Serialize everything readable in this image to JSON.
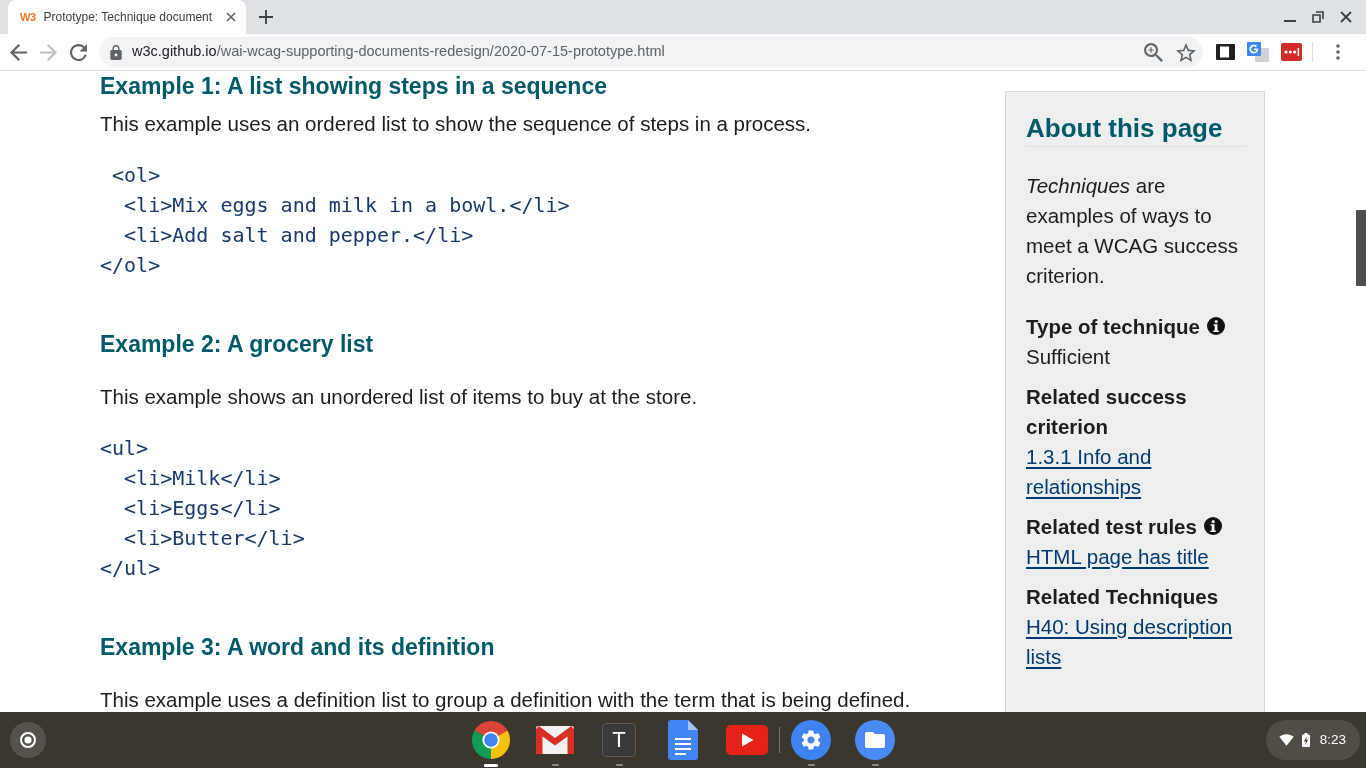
{
  "browser": {
    "tabs": [
      {
        "favicon": "W3",
        "title": "Prototype: Technique document",
        "selected": true
      }
    ],
    "nav_buttons": [
      {
        "kind": "back",
        "disabled": false
      },
      {
        "kind": "forward",
        "disabled": true
      },
      {
        "kind": "reload",
        "disabled": false
      }
    ],
    "address": {
      "host": "w3c.github.io",
      "path": "/wai-wcag-supporting-documents-redesign/2020-07-15-prototype.html"
    }
  },
  "article": {
    "blocks": [
      {
        "kind": "heading",
        "text": "Example 1: A list showing steps in a sequence"
      },
      {
        "kind": "paragraph",
        "text": "This example uses an ordered list to show the sequence of steps in a process."
      },
      {
        "kind": "code",
        "lines": [
          " <ol>",
          "  <li>Mix eggs and milk in a bowl.</li>",
          "  <li>Add salt and pepper.</li>",
          "</ol>"
        ]
      },
      {
        "kind": "heading",
        "text": "Example 2: A grocery list"
      },
      {
        "kind": "paragraph",
        "text": "This example shows an unordered list of items to buy at the store."
      },
      {
        "kind": "code",
        "lines": [
          "<ul>",
          "  <li>Milk</li>",
          "  <li>Eggs</li>",
          "  <li>Butter</li>",
          "</ul>"
        ]
      },
      {
        "kind": "heading",
        "text": "Example 3: A word and its definition"
      },
      {
        "kind": "paragraph",
        "text": "This example uses a definition list to group a definition with the term that is being defined."
      }
    ]
  },
  "sidebar": {
    "title": "About this page",
    "intro": "*Techniques* are examples of ways to meet a WCAG success criterion.",
    "sections": [
      {
        "heading": "Type of technique",
        "info": true,
        "value": "Sufficient"
      },
      {
        "heading": "Related success criterion",
        "info": false,
        "link": "1.3.1 Info and relationships"
      },
      {
        "heading": "Related test rules",
        "info": true,
        "link": "HTML page has title"
      },
      {
        "heading": "Related Techniques",
        "info": false,
        "link": "H40: Using description lists"
      }
    ]
  },
  "shelf": {
    "app_groups": [
      [
        {
          "kind": "browser",
          "running": true,
          "active": true
        },
        {
          "kind": "mail",
          "running": true,
          "active": false
        },
        {
          "kind": "letter",
          "glyph": "T",
          "running": true,
          "active": false
        },
        {
          "kind": "docs",
          "running": false,
          "active": false
        },
        {
          "kind": "video",
          "running": false,
          "active": false
        }
      ],
      [
        {
          "kind": "settings",
          "running": true,
          "active": false
        },
        {
          "kind": "files",
          "running": true,
          "active": false
        }
      ]
    ],
    "time": "8:23"
  }
}
